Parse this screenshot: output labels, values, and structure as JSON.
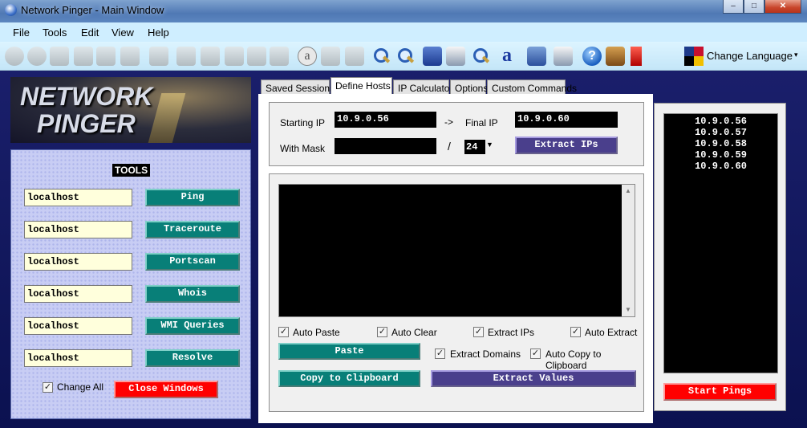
{
  "window": {
    "title": "Network Pinger - Main Window",
    "controls": {
      "minimize": "‒",
      "maximize": "□",
      "close": "✕"
    }
  },
  "menu": [
    "File",
    "Tools",
    "Edit",
    "View",
    "Help"
  ],
  "toolbar": {
    "language_label": "Change Language",
    "language_dropdown": "▾"
  },
  "logo": {
    "line1": "NETWORK",
    "line2": "PINGER"
  },
  "tools": {
    "header": "TOOLS",
    "rows": [
      {
        "host": "localhost",
        "button": "Ping"
      },
      {
        "host": "localhost",
        "button": "Traceroute"
      },
      {
        "host": "localhost",
        "button": "Portscan"
      },
      {
        "host": "localhost",
        "button": "Whois"
      },
      {
        "host": "localhost",
        "button": "WMI Queries"
      },
      {
        "host": "localhost",
        "button": "Resolve"
      }
    ],
    "change_all_label": "Change All",
    "change_all_checked": true,
    "close_windows_label": "Close Windows"
  },
  "tabs": [
    "Saved Sessions",
    "Define Hosts",
    "IP Calculator",
    "Options",
    "Custom Commands"
  ],
  "active_tab": "Define Hosts",
  "define_hosts": {
    "starting_ip_label": "Starting IP",
    "starting_ip_value": "10.9.0.56",
    "arrow": "->",
    "final_ip_label": "Final IP",
    "final_ip_value": "10.9.0.60",
    "with_mask_label": "With Mask",
    "mask_value": "",
    "slash": "/",
    "cidr_value": "24",
    "extract_ips_button": "Extract IPs",
    "options": {
      "auto_paste": {
        "label": "Auto Paste",
        "checked": true
      },
      "auto_clear": {
        "label": "Auto Clear",
        "checked": true
      },
      "extract_ips": {
        "label": "Extract IPs",
        "checked": true
      },
      "auto_extract": {
        "label": "Auto Extract",
        "checked": true
      },
      "extract_domains": {
        "label": "Extract Domains",
        "checked": true
      },
      "auto_copy": {
        "label": "Auto Copy to Clipboard",
        "checked": true
      }
    },
    "paste_button": "Paste",
    "copy_button": "Copy to Clipboard",
    "extract_values_button": "Extract Values"
  },
  "host_list": [
    "10.9.0.56",
    "10.9.0.57",
    "10.9.0.58",
    "10.9.0.59",
    "10.9.0.60"
  ],
  "start_pings_button": "Start Pings",
  "colors": {
    "accent_teal": "#087f78",
    "accent_red": "#ff0000",
    "accent_purple": "#4a3f8c",
    "background_navy": "#0b1150"
  }
}
